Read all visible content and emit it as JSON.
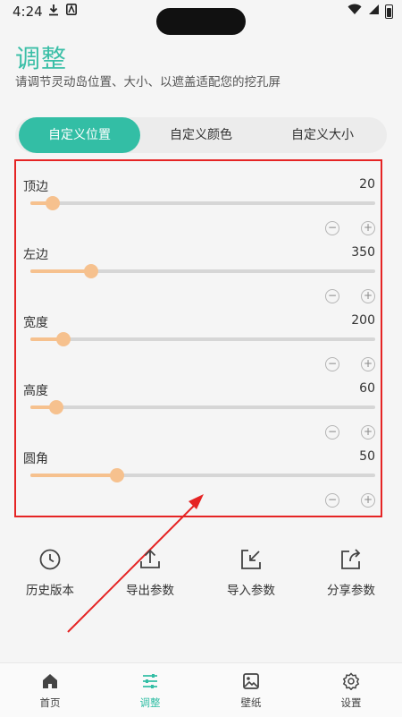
{
  "status": {
    "time": "4:24"
  },
  "header": {
    "title": "调整",
    "subtitle": "请调节灵动岛位置、大小、以遮盖适配您的挖孔屏"
  },
  "tabs": [
    {
      "label": "自定义位置",
      "active": true
    },
    {
      "label": "自定义颜色",
      "active": false
    },
    {
      "label": "自定义大小",
      "active": false
    }
  ],
  "sliders": [
    {
      "label": "顶边",
      "value": "20",
      "fraction": 0.065
    },
    {
      "label": "左边",
      "value": "350",
      "fraction": 0.175
    },
    {
      "label": "宽度",
      "value": "200",
      "fraction": 0.095
    },
    {
      "label": "高度",
      "value": "60",
      "fraction": 0.075
    },
    {
      "label": "圆角",
      "value": "50",
      "fraction": 0.25
    }
  ],
  "stepper": {
    "minus": "−",
    "plus": "+"
  },
  "actions": [
    {
      "label": "历史版本",
      "icon": "clock-icon"
    },
    {
      "label": "导出参数",
      "icon": "upload-icon"
    },
    {
      "label": "导入参数",
      "icon": "import-icon"
    },
    {
      "label": "分享参数",
      "icon": "share-icon"
    }
  ],
  "nav": [
    {
      "label": "首页",
      "icon": "home-icon",
      "active": false
    },
    {
      "label": "调整",
      "icon": "sliders-icon",
      "active": true
    },
    {
      "label": "壁纸",
      "icon": "image-icon",
      "active": false
    },
    {
      "label": "设置",
      "icon": "gear-icon",
      "active": false
    }
  ],
  "colors": {
    "accent": "#33bea5",
    "slider": "#f6c18e",
    "highlight": "#e52424"
  }
}
